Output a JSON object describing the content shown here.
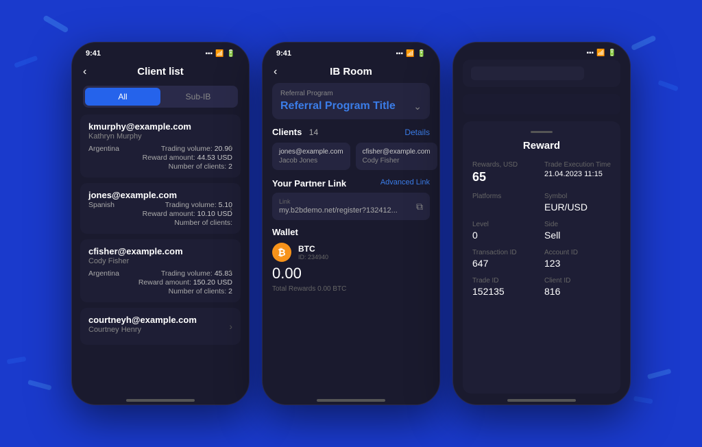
{
  "background": {
    "color": "#1a3acc"
  },
  "phone1": {
    "statusBar": {
      "time": "9:41"
    },
    "title": "Client list",
    "tabs": [
      "All",
      "Sub-IB"
    ],
    "activeTab": "All",
    "clients": [
      {
        "email": "kmurphy@example.com",
        "name": "Kathryn Murphy",
        "country": "Argentina",
        "tradingVolume": "20.90",
        "rewardAmount": "44.53 USD",
        "numberOfClients": "2"
      },
      {
        "email": "jones@example.com",
        "name": "",
        "country": "Spanish",
        "tradingVolume": "5.10",
        "rewardAmount": "10.10 USD",
        "numberOfClients": ""
      },
      {
        "email": "cfisher@example.com",
        "name": "Cody Fisher",
        "country": "Argentina",
        "tradingVolume": "45.83",
        "rewardAmount": "150.20 USD",
        "numberOfClients": "2"
      },
      {
        "email": "courtneyh@example.com",
        "name": "Courtney Henry",
        "country": "",
        "tradingVolume": "",
        "rewardAmount": "",
        "numberOfClients": ""
      }
    ],
    "labels": {
      "tradingVolume": "Trading volume:",
      "rewardAmount": "Reward amount:",
      "numberOfClients": "Number of clients:"
    }
  },
  "phone2": {
    "statusBar": {
      "time": "9:41"
    },
    "title": "IB Room",
    "referral": {
      "label": "Referral Program",
      "title": "Referral Program Title"
    },
    "clients": {
      "label": "Clients",
      "count": "14",
      "detailsLink": "Details",
      "list": [
        {
          "email": "jones@example.com",
          "name": "Jacob Jones"
        },
        {
          "email": "cfisher@example.com",
          "name": "Cody Fisher"
        }
      ]
    },
    "partnerLink": {
      "label": "Your Partner Link",
      "advancedLink": "Advanced Link",
      "linkLabel": "Link",
      "linkValue": "my.b2bdemo.net/register?132412..."
    },
    "wallet": {
      "label": "Wallet",
      "coin": {
        "symbol": "BTC",
        "id": "ID: 234940",
        "amount": "0.00"
      },
      "totalRewards": "Total Rewards 0.00 BTC"
    }
  },
  "phone3": {
    "statusBar": {
      "time": ""
    },
    "reward": {
      "title": "Reward",
      "fields": [
        {
          "label": "Rewards, USD",
          "value": "65",
          "large": true
        },
        {
          "label": "Trade Execution Time",
          "value": "21.04.2023 11:15"
        },
        {
          "label": "Platforms",
          "value": ""
        },
        {
          "label": "Symbol",
          "value": "EUR/USD"
        },
        {
          "label": "Level",
          "value": "0"
        },
        {
          "label": "Side",
          "value": "Sell"
        },
        {
          "label": "Transaction ID",
          "value": "647"
        },
        {
          "label": "Account ID",
          "value": "123"
        },
        {
          "label": "Trade ID",
          "value": "152135"
        },
        {
          "label": "Client ID",
          "value": "816"
        }
      ]
    }
  }
}
